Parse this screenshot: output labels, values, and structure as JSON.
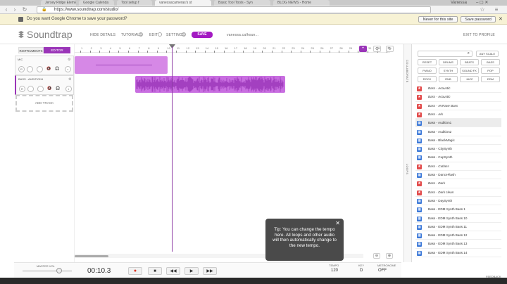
{
  "browser": {
    "tabs": [
      {
        "label": "Jersey Ridge Elementar"
      },
      {
        "label": "Google Calenda"
      },
      {
        "label": "Tool setup f"
      },
      {
        "label": "vanessacameras's st"
      },
      {
        "label": "Basic Tool Tools - Syn"
      },
      {
        "label": "BLOG NEWS - Home"
      }
    ],
    "user": "Vanessa",
    "url": "https://www.soundtrap.com/studio/",
    "infobar": {
      "message": "Do you want Google Chrome to save your password?",
      "never_label": "Never for this site",
      "save_label": "Save password"
    }
  },
  "app": {
    "logo": "Soundtrap",
    "nav": {
      "hide_details": "HIDE DETAILS",
      "tutorials": "TUTORIALS",
      "edit": "EDIT",
      "settings": "SETTINGS",
      "save": "SAVE",
      "username": "vanessa.calhoun...",
      "exit": "EXIT TO PROFILE"
    }
  },
  "left": {
    "tabs": [
      "INSTRUMENTS",
      "EDITOR"
    ],
    "tracks": [
      {
        "name": "MIC"
      },
      {
        "name": "BASS - AUDITION1"
      }
    ],
    "add_track": "ADD TRACK"
  },
  "timeline": {
    "ticks": [
      "1",
      "2",
      "3",
      "4",
      "5",
      "6",
      "7",
      "8",
      "9",
      "10",
      "11",
      "12",
      "13",
      "14",
      "15",
      "16",
      "17",
      "18",
      "19",
      "20",
      "21",
      "22",
      "23",
      "24",
      "25",
      "26",
      "27",
      "28",
      "29",
      "30",
      "31",
      "32",
      "33"
    ]
  },
  "side_tabs": {
    "collaborate": "COLLABORATE",
    "loops": "LOOPS"
  },
  "loops": {
    "search_placeholder": "",
    "any_scale": "ANY SCALE",
    "filters": [
      "RESET",
      "DRUMS",
      "BEATS",
      "BASS",
      "PIANO",
      "SYNTH",
      "SOUND FX",
      "POP",
      "ROCK",
      "RNB",
      "JAZZ",
      "EDM"
    ],
    "items": [
      {
        "label": "Bass - Acoustic",
        "icon": "star-icon",
        "italic": true
      },
      {
        "label": "Bass - Acoustic",
        "icon": "star-icon",
        "italic": true
      },
      {
        "label": "Bass - AVRave Bass",
        "icon": "star-icon",
        "italic": true
      },
      {
        "label": "Bass - Ark",
        "icon": "star-icon",
        "italic": true
      },
      {
        "label": "Bass - Audition1",
        "icon": "keyboard-icon",
        "italic": false,
        "selected": true
      },
      {
        "label": "Bass - Audition2",
        "icon": "keyboard-icon",
        "italic": false
      },
      {
        "label": "Bass - BlackMagic",
        "icon": "keyboard-icon",
        "italic": false
      },
      {
        "label": "Bass - CitySynth",
        "icon": "keyboard-icon",
        "italic": false
      },
      {
        "label": "Bass - CupSynth",
        "icon": "keyboard-icon",
        "italic": false
      },
      {
        "label": "Bass - Cutlass",
        "icon": "star-icon",
        "italic": true
      },
      {
        "label": "Bass - DanceFlash",
        "icon": "keyboard-icon",
        "italic": false
      },
      {
        "label": "Bass - Dark",
        "icon": "star-icon",
        "italic": true
      },
      {
        "label": "Bass - Dark clean",
        "icon": "star-icon",
        "italic": true
      },
      {
        "label": "Bass - DaySynth",
        "icon": "keyboard-icon",
        "italic": false
      },
      {
        "label": "Bass - EDM Synth Bass 1",
        "icon": "keyboard-icon",
        "italic": false
      },
      {
        "label": "Bass - EDM Synth Bass 10",
        "icon": "keyboard-icon",
        "italic": false
      },
      {
        "label": "Bass - EDM Synth Bass 11",
        "icon": "keyboard-icon",
        "italic": false
      },
      {
        "label": "Bass - EDM Synth Bass 12",
        "icon": "keyboard-icon",
        "italic": false
      },
      {
        "label": "Bass - EDM Synth Bass 13",
        "icon": "keyboard-icon",
        "italic": false
      },
      {
        "label": "Bass - EDM Synth Bass 14",
        "icon": "keyboard-icon",
        "italic": false
      }
    ]
  },
  "tooltip": {
    "text": "Tip: You can change the tempo here. All loops and other audio will then automatically change to the new tempo."
  },
  "transport": {
    "master_vol_label": "MASTER VOL",
    "time": "00:10.3",
    "tempo_label": "TEMPO",
    "tempo": "120",
    "key_label": "KEY",
    "key": "D",
    "metronome_label": "METRONOME",
    "metronome": "OFF",
    "feedback": "FEEDBACK"
  },
  "colors": {
    "accent": "#a31ac2",
    "clip": "#c86ee0",
    "clip_dark": "#9a35b8",
    "star_red": "#e24b4b",
    "keys_blue": "#3b78d8"
  }
}
